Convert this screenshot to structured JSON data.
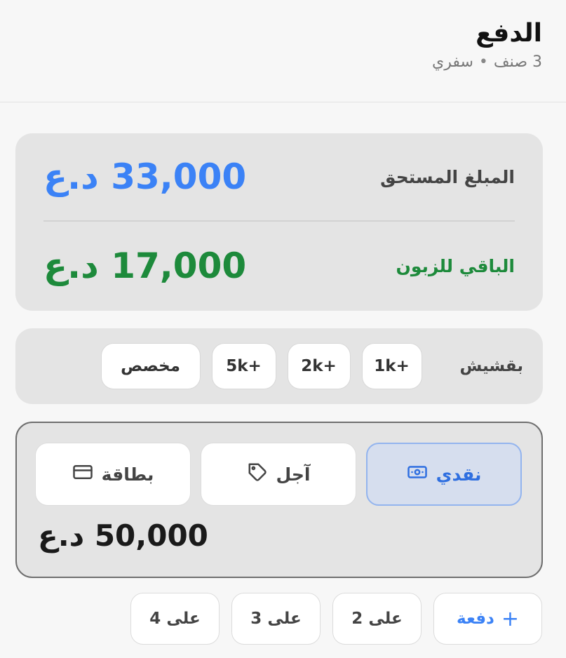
{
  "header": {
    "title": "الدفع",
    "items_count": "3 صنف",
    "separator": "•",
    "order_type": "سفري"
  },
  "summary": {
    "due_label": "المبلغ المستحق",
    "due_amount": "33,000 د.ع",
    "change_label": "الباقي للزبون",
    "change_amount": "17,000 د.ع",
    "due_color": "#3b82f6",
    "change_color": "#1d8a3b"
  },
  "tip": {
    "label": "بقشيش",
    "options": [
      "+1k",
      "+2k",
      "+5k",
      "مخصص"
    ]
  },
  "payment": {
    "methods": [
      {
        "label": "نقدي",
        "icon": "cash-icon",
        "active": true
      },
      {
        "label": "آجل",
        "icon": "tag-icon",
        "active": false
      },
      {
        "label": "بطاقة",
        "icon": "card-icon",
        "active": false
      }
    ],
    "entered_amount": "50,000 د.ع"
  },
  "split": {
    "add_label": "دفعة",
    "options": [
      "على 2",
      "على 3",
      "على 4"
    ]
  }
}
